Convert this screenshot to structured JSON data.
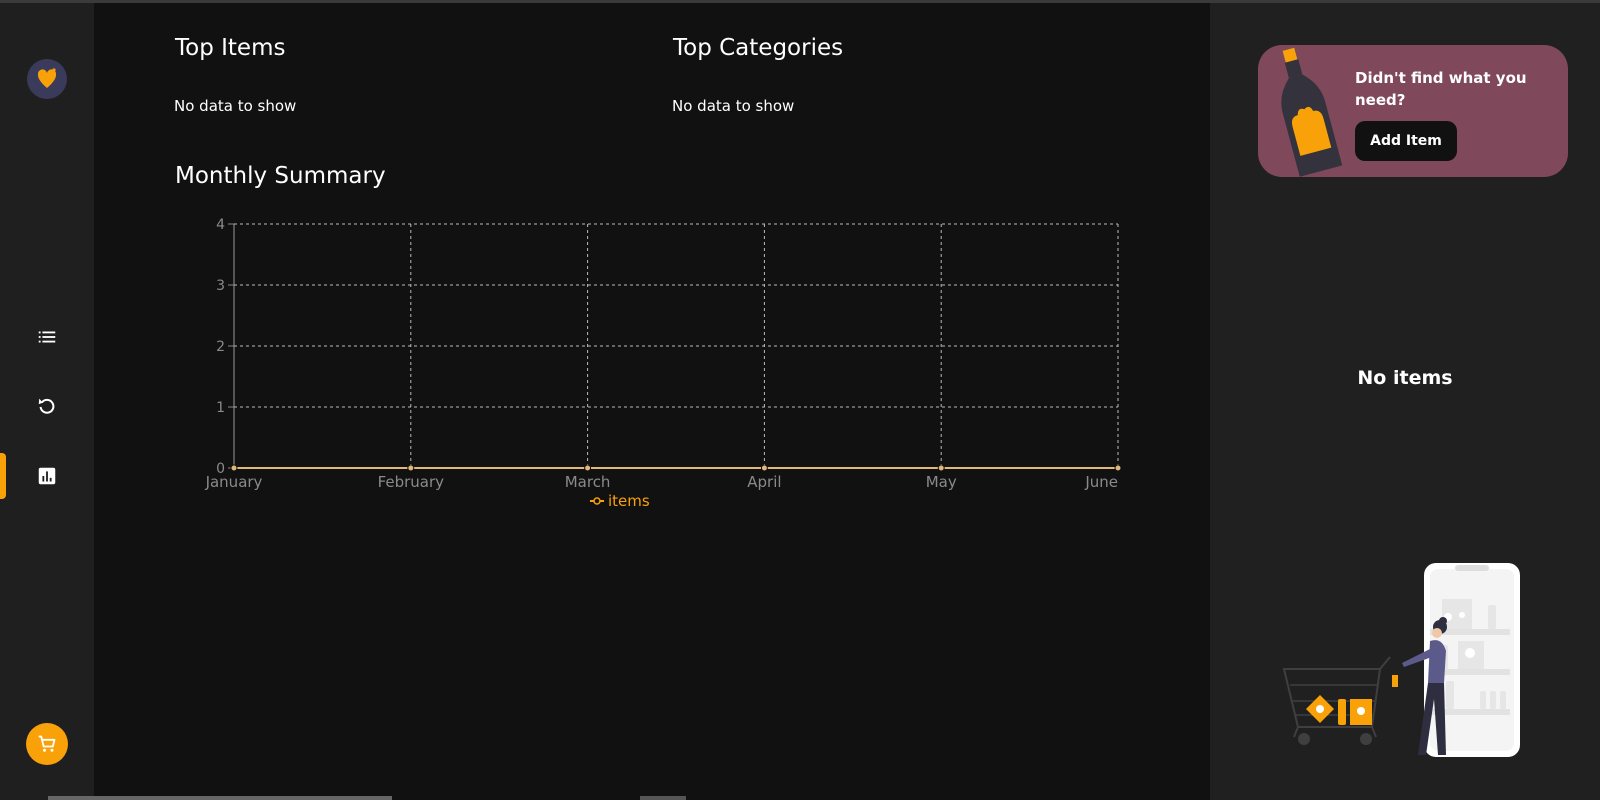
{
  "main": {
    "top_items": {
      "title": "Top Items",
      "empty": "No data to show"
    },
    "top_categories": {
      "title": "Top Categories",
      "empty": "No data to show"
    },
    "monthly_summary": {
      "title": "Monthly Summary"
    }
  },
  "chart_data": {
    "type": "line",
    "title": "Monthly Summary",
    "categories": [
      "January",
      "February",
      "March",
      "April",
      "May",
      "June"
    ],
    "series": [
      {
        "name": "items",
        "values": [
          0,
          0,
          0,
          0,
          0,
          0
        ]
      }
    ],
    "yticks": [
      "0",
      "1",
      "2",
      "3",
      "4"
    ],
    "ylim": [
      0,
      4
    ],
    "grid": true,
    "legend": "bottom-center"
  },
  "right_panel": {
    "promo_text": "Didn't find what you need?",
    "add_item_label": "Add Item",
    "empty_text": "No items"
  },
  "sidebar": {
    "items": [
      {
        "icon": "list-icon"
      },
      {
        "icon": "history-icon"
      },
      {
        "icon": "statistics-icon",
        "active": true
      }
    ],
    "cart_icon": "cart-icon"
  },
  "colors": {
    "accent": "#f9a109",
    "promo_bg": "#80485b",
    "sidebar_bg": "#1f1f1f",
    "main_bg": "#111111",
    "right_bg": "#202020",
    "line": "#e0b97a"
  }
}
